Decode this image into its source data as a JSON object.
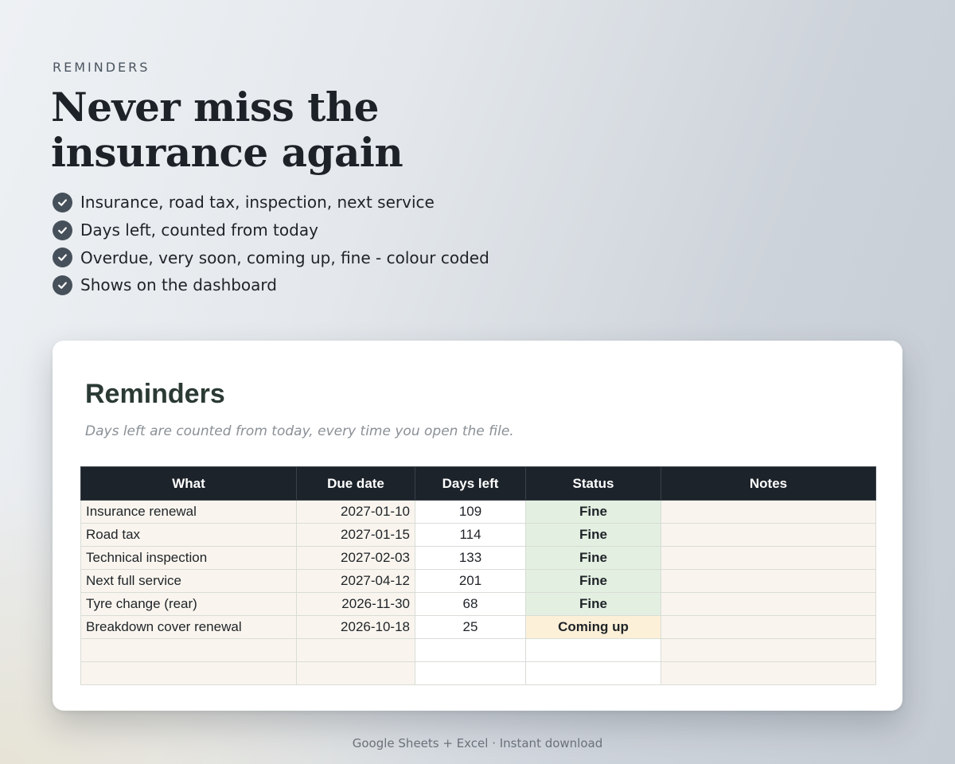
{
  "hero": {
    "eyebrow": "REMINDERS",
    "headline_line1": "Never miss the",
    "headline_line2": "insurance again",
    "features": [
      "Insurance, road tax, inspection, next service",
      "Days left, counted from today",
      "Overdue, very soon, coming up, fine - colour coded",
      "Shows on the dashboard"
    ],
    "feature_icon": "check-circle-icon"
  },
  "card": {
    "title": "Reminders",
    "subtitle": "Days left are counted from today, every time you open the file.",
    "columns": [
      "What",
      "Due date",
      "Days left",
      "Status",
      "Notes"
    ],
    "rows": [
      {
        "what": "Insurance renewal",
        "due": "2027-01-10",
        "days": "109",
        "status": "Fine",
        "notes": ""
      },
      {
        "what": "Road tax",
        "due": "2027-01-15",
        "days": "114",
        "status": "Fine",
        "notes": ""
      },
      {
        "what": "Technical inspection",
        "due": "2027-02-03",
        "days": "133",
        "status": "Fine",
        "notes": ""
      },
      {
        "what": "Next full service",
        "due": "2027-04-12",
        "days": "201",
        "status": "Fine",
        "notes": ""
      },
      {
        "what": "Tyre change (rear)",
        "due": "2026-11-30",
        "days": "68",
        "status": "Fine",
        "notes": ""
      },
      {
        "what": "Breakdown cover renewal",
        "due": "2026-10-18",
        "days": "25",
        "status": "Coming up",
        "notes": ""
      },
      {
        "what": "",
        "due": "",
        "days": "",
        "status": "",
        "notes": ""
      },
      {
        "what": "",
        "due": "",
        "days": "",
        "status": "",
        "notes": ""
      }
    ]
  },
  "colors": {
    "header_bg": "#1d232a",
    "status_fine": "#e3efe1",
    "status_coming_up": "#fcf0d8",
    "row_bg": "#f9f5ee"
  },
  "footer": {
    "text": "Google Sheets + Excel  ·  Instant download"
  }
}
